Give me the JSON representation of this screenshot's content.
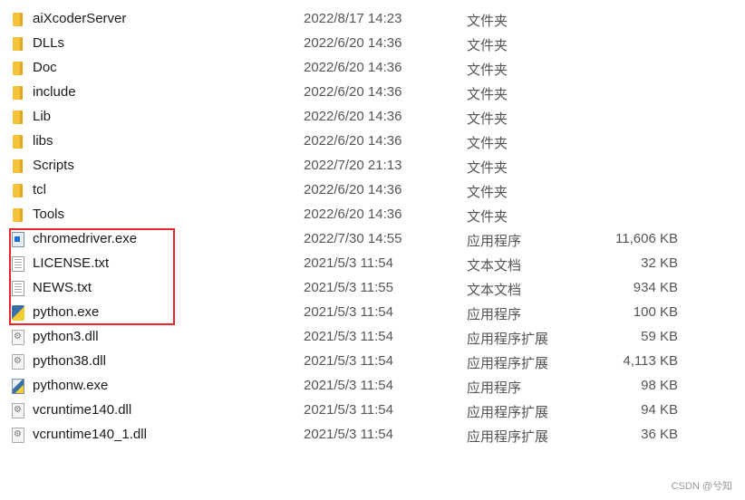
{
  "files": [
    {
      "name": "aiXcoderServer",
      "date": "2022/8/17 14:23",
      "type": "文件夹",
      "size": "",
      "icon": "folder"
    },
    {
      "name": "DLLs",
      "date": "2022/6/20 14:36",
      "type": "文件夹",
      "size": "",
      "icon": "folder"
    },
    {
      "name": "Doc",
      "date": "2022/6/20 14:36",
      "type": "文件夹",
      "size": "",
      "icon": "folder"
    },
    {
      "name": "include",
      "date": "2022/6/20 14:36",
      "type": "文件夹",
      "size": "",
      "icon": "folder"
    },
    {
      "name": "Lib",
      "date": "2022/6/20 14:36",
      "type": "文件夹",
      "size": "",
      "icon": "folder"
    },
    {
      "name": "libs",
      "date": "2022/6/20 14:36",
      "type": "文件夹",
      "size": "",
      "icon": "folder"
    },
    {
      "name": "Scripts",
      "date": "2022/7/20 21:13",
      "type": "文件夹",
      "size": "",
      "icon": "folder"
    },
    {
      "name": "tcl",
      "date": "2022/6/20 14:36",
      "type": "文件夹",
      "size": "",
      "icon": "folder"
    },
    {
      "name": "Tools",
      "date": "2022/6/20 14:36",
      "type": "文件夹",
      "size": "",
      "icon": "folder"
    },
    {
      "name": "chromedriver.exe",
      "date": "2022/7/30 14:55",
      "type": "应用程序",
      "size": "11,606 KB",
      "icon": "exe"
    },
    {
      "name": "LICENSE.txt",
      "date": "2021/5/3 11:54",
      "type": "文本文档",
      "size": "32 KB",
      "icon": "doc"
    },
    {
      "name": "NEWS.txt",
      "date": "2021/5/3 11:55",
      "type": "文本文档",
      "size": "934 KB",
      "icon": "doc"
    },
    {
      "name": "python.exe",
      "date": "2021/5/3 11:54",
      "type": "应用程序",
      "size": "100 KB",
      "icon": "py"
    },
    {
      "name": "python3.dll",
      "date": "2021/5/3 11:54",
      "type": "应用程序扩展",
      "size": "59 KB",
      "icon": "dll"
    },
    {
      "name": "python38.dll",
      "date": "2021/5/3 11:54",
      "type": "应用程序扩展",
      "size": "4,113 KB",
      "icon": "dll"
    },
    {
      "name": "pythonw.exe",
      "date": "2021/5/3 11:54",
      "type": "应用程序",
      "size": "98 KB",
      "icon": "pyw"
    },
    {
      "name": "vcruntime140.dll",
      "date": "2021/5/3 11:54",
      "type": "应用程序扩展",
      "size": "94 KB",
      "icon": "dll"
    },
    {
      "name": "vcruntime140_1.dll",
      "date": "2021/5/3 11:54",
      "type": "应用程序扩展",
      "size": "36 KB",
      "icon": "dll"
    }
  ],
  "highlight_color": "#e8262b",
  "watermark": "CSDN @兮知"
}
